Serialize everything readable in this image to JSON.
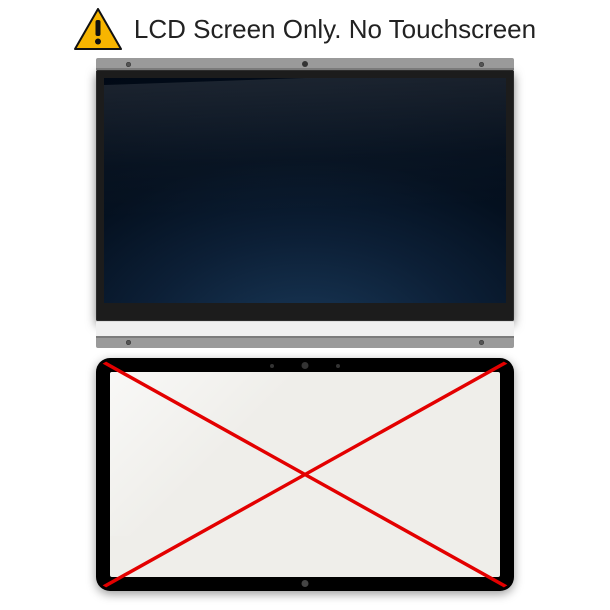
{
  "header": {
    "text": "LCD Screen Only. No Touchscreen",
    "warning_color": "#F7B500",
    "warning_border": "#111111"
  },
  "cross": {
    "color": "#E30000"
  }
}
